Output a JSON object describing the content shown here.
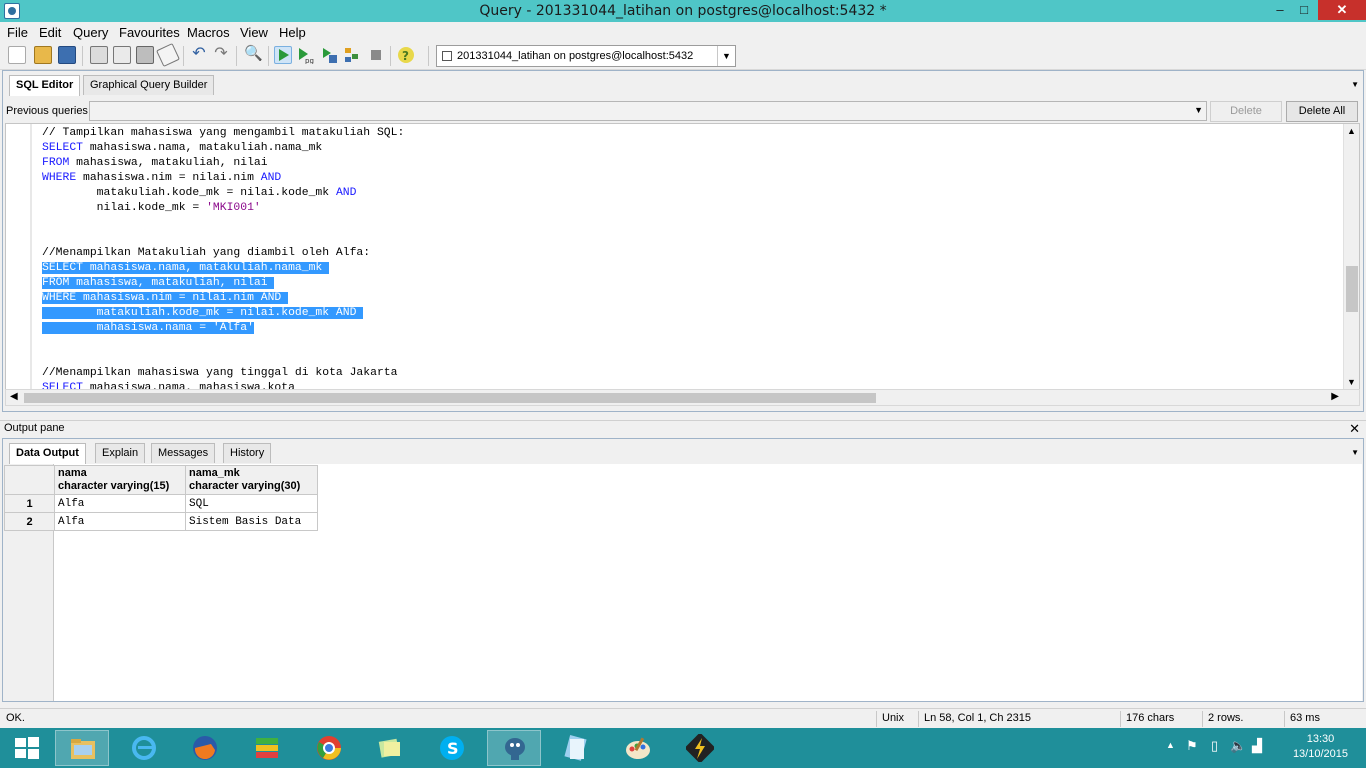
{
  "window": {
    "title": "Query - 201331044_latihan on postgres@localhost:5432 *",
    "minimize": "–",
    "maximize": "□",
    "close": "✕"
  },
  "menu": [
    "File",
    "Edit",
    "Query",
    "Favourites",
    "Macros",
    "View",
    "Help"
  ],
  "toolbar": {
    "connection": "201331044_latihan on postgres@localhost:5432",
    "icons": [
      "new-icon",
      "open-icon",
      "save-icon",
      "cut-icon",
      "copy-icon",
      "paste-icon",
      "clear-icon",
      "undo-icon",
      "redo-icon",
      "find-icon",
      "execute-icon",
      "execute-pgscript-icon",
      "execute-to-file-icon",
      "explain-icon",
      "cancel-icon",
      "help-icon"
    ]
  },
  "editor": {
    "tabs": [
      "SQL Editor",
      "Graphical Query Builder"
    ],
    "previous_queries_label": "Previous queries",
    "delete_button": "Delete",
    "delete_all_button": "Delete All",
    "lines": [
      [
        {
          "t": "// Tampilkan mahasiswa yang mengambil matakuliah SQL:",
          "c": "cm"
        }
      ],
      [
        {
          "t": "SELECT",
          "c": "kw"
        },
        {
          "t": " mahasiswa.nama, matakuliah.nama_mk",
          "c": ""
        }
      ],
      [
        {
          "t": "FROM",
          "c": "kw"
        },
        {
          "t": " mahasiswa, matakuliah, nilai",
          "c": ""
        }
      ],
      [
        {
          "t": "WHERE",
          "c": "kw"
        },
        {
          "t": " mahasiswa.nim = nilai.nim ",
          "c": ""
        },
        {
          "t": "AND",
          "c": "kw"
        }
      ],
      [
        {
          "t": "        matakuliah.kode_mk = nilai.kode_mk ",
          "c": ""
        },
        {
          "t": "AND",
          "c": "kw"
        }
      ],
      [
        {
          "t": "        nilai.kode_mk = ",
          "c": ""
        },
        {
          "t": "'MKI001'",
          "c": "str"
        }
      ],
      [],
      [],
      [
        {
          "t": "//Menampilkan Matakuliah yang diambil oleh Alfa:",
          "c": "cm"
        }
      ],
      [
        {
          "t": "SELECT mahasiswa.nama, matakuliah.nama_mk ",
          "c": "sel"
        }
      ],
      [
        {
          "t": "FROM mahasiswa, matakuliah, nilai ",
          "c": "sel"
        }
      ],
      [
        {
          "t": "WHERE mahasiswa.nim = nilai.nim AND ",
          "c": "sel"
        }
      ],
      [
        {
          "t": "        matakuliah.kode_mk = nilai.kode_mk AND ",
          "c": "sel"
        }
      ],
      [
        {
          "t": "        mahasiswa.nama = 'Alfa'",
          "c": "sel"
        }
      ],
      [],
      [],
      [
        {
          "t": "//Menampilkan mahasiswa yang tinggal di kota Jakarta",
          "c": "cm"
        }
      ],
      [
        {
          "t": "SELECT",
          "c": "kw"
        },
        {
          "t": " mahasiswa.nama, mahasiswa.kota",
          "c": ""
        }
      ]
    ]
  },
  "output": {
    "pane_label": "Output pane",
    "close": "✕",
    "tabs": [
      "Data Output",
      "Explain",
      "Messages",
      "History"
    ],
    "columns": [
      {
        "name": "nama",
        "type": "character varying(15)"
      },
      {
        "name": "nama_mk",
        "type": "character varying(30)"
      }
    ],
    "rows": [
      {
        "n": "1",
        "cells": [
          "Alfa",
          "SQL"
        ]
      },
      {
        "n": "2",
        "cells": [
          "Alfa",
          "Sistem Basis Data"
        ]
      }
    ]
  },
  "status": {
    "message": "OK.",
    "line_ending": "Unix",
    "position": "Ln 58, Col 1, Ch 2315",
    "chars": "176 chars",
    "rows": "2 rows.",
    "time": "63 ms"
  },
  "taskbar": {
    "apps": [
      "start-icon",
      "file-explorer-icon",
      "internet-explorer-icon",
      "firefox-icon",
      "bluestacks-icon",
      "chrome-icon",
      "notes-icon",
      "skype-icon",
      "pgadmin-icon",
      "notepad-icon",
      "paint-icon",
      "winamp-icon"
    ],
    "clock_time": "13:30",
    "clock_date": "13/10/2015"
  },
  "colors": {
    "titlebar": "#4fc6c7",
    "taskbar": "#1f8f9a",
    "selection": "#3399ff",
    "keyword": "#1a1aff",
    "string": "#8b0a8b"
  }
}
